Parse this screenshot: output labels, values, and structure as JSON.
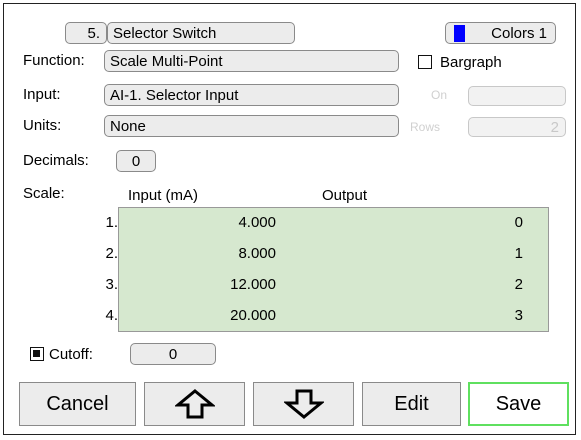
{
  "header": {
    "number": "5.",
    "name": "Selector Switch",
    "colors_label": "Colors 1",
    "colors_swatch": "#0000ff"
  },
  "function": {
    "label": "Function:",
    "value": "Scale Multi-Point"
  },
  "bargraph": {
    "label": "Bargraph",
    "checked": false
  },
  "input": {
    "label": "Input:",
    "value": "AI-1. Selector Input"
  },
  "units": {
    "label": "Units:",
    "value": "None"
  },
  "disabled_controls": {
    "top_label": "On",
    "top_value": "",
    "bottom_label": "Rows",
    "bottom_value": "2"
  },
  "decimals": {
    "label": "Decimals:",
    "value": "0"
  },
  "scale": {
    "label": "Scale:",
    "input_header": "Input (mA)",
    "output_header": "Output",
    "rows": [
      {
        "index": "1.",
        "input": "4.000",
        "output": "0"
      },
      {
        "index": "2.",
        "input": "8.000",
        "output": "1"
      },
      {
        "index": "3.",
        "input": "12.000",
        "output": "2"
      },
      {
        "index": "4.",
        "input": "20.000",
        "output": "3"
      }
    ]
  },
  "cutoff": {
    "label": "Cutoff:",
    "value": "0",
    "checked": true
  },
  "buttons": {
    "cancel": "Cancel",
    "up_icon": "arrow-up-icon",
    "down_icon": "arrow-down-icon",
    "edit": "Edit",
    "save": "Save"
  },
  "colors": {
    "save_border": "#5fe05f",
    "table_bg": "#d6e8cf"
  }
}
